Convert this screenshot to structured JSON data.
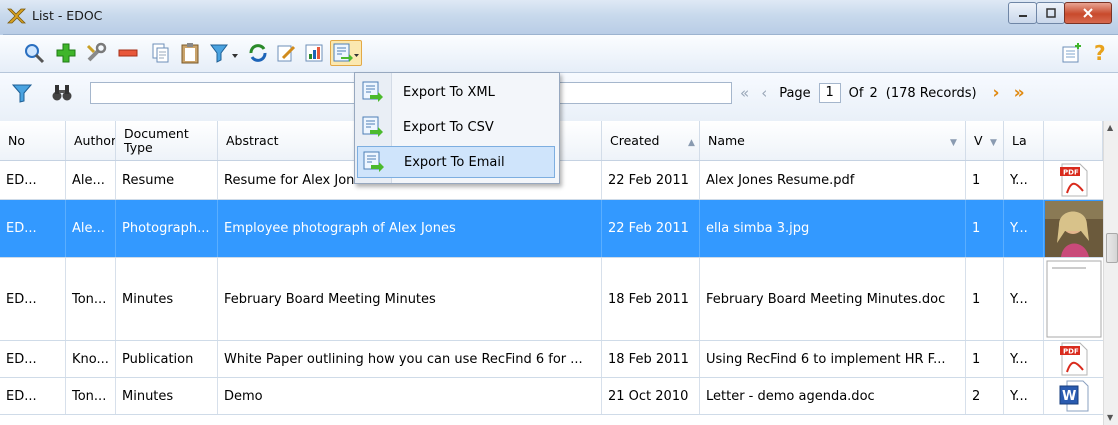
{
  "window": {
    "title": "List - EDOC"
  },
  "colors": {
    "selection": "#3399ff",
    "accent": "#e3a946"
  },
  "toolbar": {
    "icons": [
      "search-icon",
      "add-icon",
      "tools-icon",
      "remove-icon",
      "copy-icon",
      "clipboard-icon",
      "filter-dropdown-icon",
      "refresh-icon",
      "edit-icon",
      "report-icon",
      "export-dropdown-icon"
    ],
    "right_icons": [
      "new-record-icon",
      "help-icon"
    ]
  },
  "paging": {
    "page_label": "Page",
    "page": "1",
    "of_label": "Of",
    "total_pages": "2",
    "records": "(178 Records)"
  },
  "export_menu": {
    "items": [
      {
        "label": "Export To XML"
      },
      {
        "label": "Export To CSV"
      },
      {
        "label": "Export To Email"
      }
    ]
  },
  "grid": {
    "columns": [
      "No",
      "Author",
      "Document Type",
      "Abstract",
      "Created",
      "Name",
      "V",
      "La"
    ],
    "rows": [
      {
        "no": "ED...",
        "author": "Ale...",
        "type": "Resume",
        "abstract": "Resume for Alex Jones",
        "created": "22 Feb 2011",
        "name": "Alex Jones Resume.pdf",
        "v": "1",
        "la": "Y...",
        "thumb": "pdf-icon"
      },
      {
        "no": "ED...",
        "author": "Ale...",
        "type": "Photograph...",
        "abstract": "Employee photograph of Alex Jones",
        "created": "22 Feb 2011",
        "name": "ella simba 3.jpg",
        "v": "1",
        "la": "Y...",
        "thumb": "photo-thumbnail"
      },
      {
        "no": "ED...",
        "author": "Ton...",
        "type": "Minutes",
        "abstract": "February Board Meeting Minutes",
        "created": "18 Feb 2011",
        "name": "February Board Meeting Minutes.doc",
        "v": "1",
        "la": "Y...",
        "thumb": "document-thumbnail"
      },
      {
        "no": "ED...",
        "author": "Kno...",
        "type": "Publication",
        "abstract": "White Paper outlining how you can use RecFind 6 for ...",
        "created": "18 Feb 2011",
        "name": "Using RecFind 6 to implement HR F...",
        "v": "1",
        "la": "Y...",
        "thumb": "pdf-icon"
      },
      {
        "no": "ED...",
        "author": "Ton...",
        "type": "Minutes",
        "abstract": "Demo",
        "created": "21 Oct 2010",
        "name": "Letter - demo agenda.doc",
        "v": "2",
        "la": "Y...",
        "thumb": "word-icon"
      }
    ]
  }
}
